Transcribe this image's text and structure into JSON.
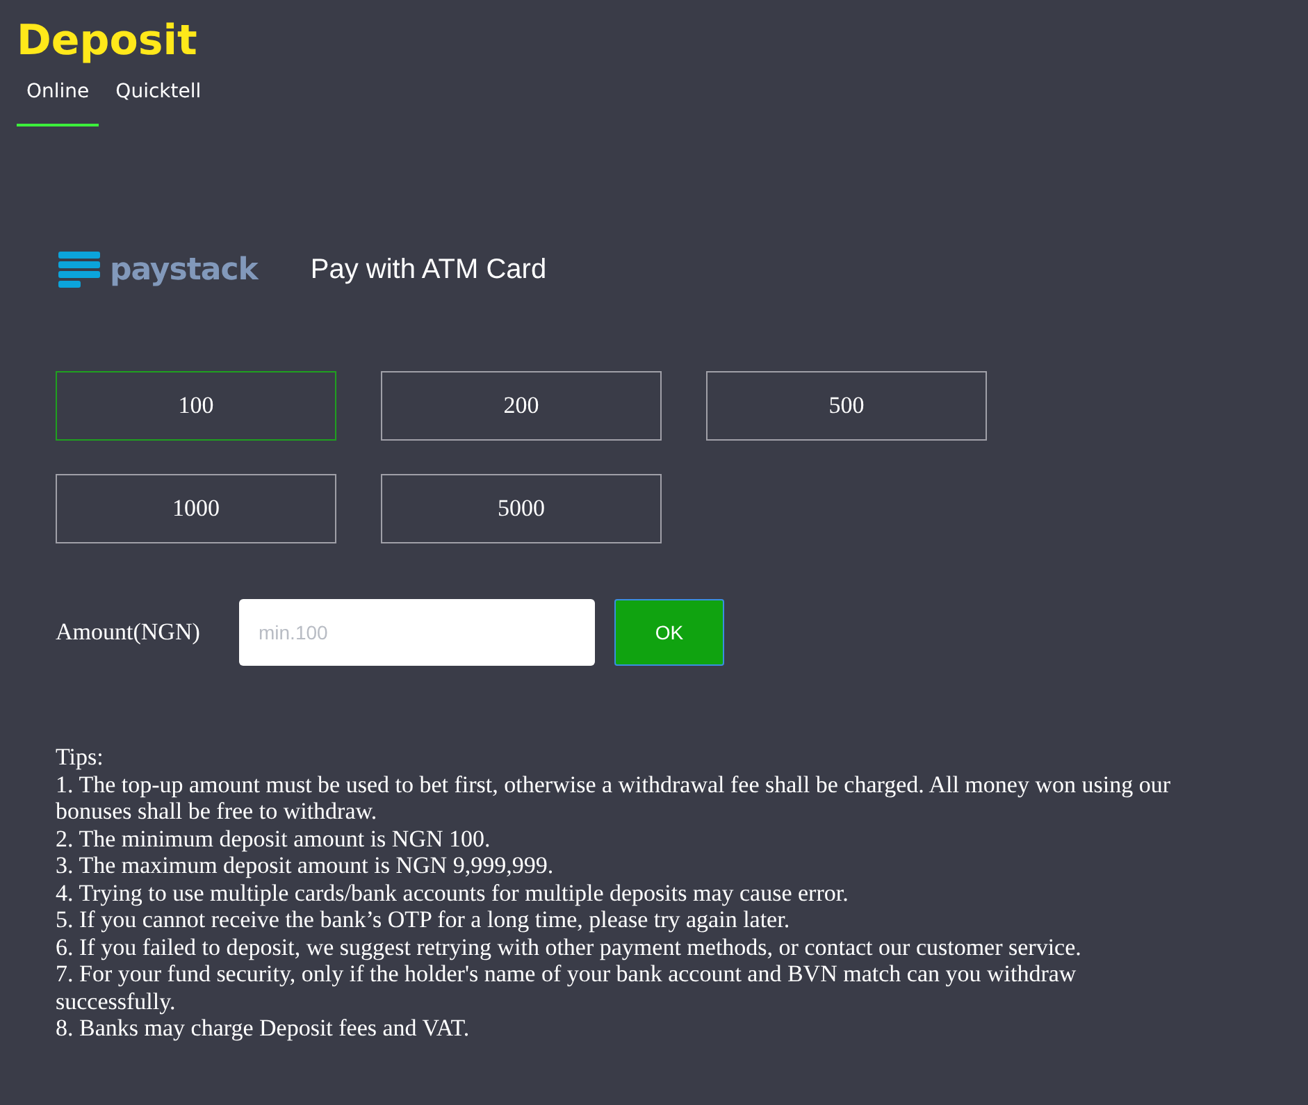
{
  "title": "Deposit",
  "tabs": [
    {
      "label": "Online",
      "selected": true
    },
    {
      "label": "Quicktell",
      "selected": false
    }
  ],
  "provider": {
    "logo_text": "paystack",
    "caption": "Pay with ATM Card"
  },
  "amounts": [
    {
      "label": "100",
      "selected": true
    },
    {
      "label": "200",
      "selected": false
    },
    {
      "label": "500",
      "selected": false
    },
    {
      "label": "1000",
      "selected": false
    },
    {
      "label": "5000",
      "selected": false
    }
  ],
  "amount_field": {
    "label": "Amount(NGN)",
    "placeholder": "min.100"
  },
  "ok_button": "OK",
  "tips": {
    "heading": "Tips:",
    "items": [
      "1. The top-up amount must be used to bet first, otherwise a withdrawal fee shall be charged. All money won using our bonuses shall be free to withdraw.",
      "2. The minimum deposit amount is NGN 100.",
      "3. The maximum deposit amount is NGN 9,999,999.",
      "4. Trying to use multiple cards/bank accounts for multiple deposits may cause error.",
      "5. If you cannot receive the bank’s OTP for a long time, please try again later.",
      "6. If you failed to deposit, we suggest retrying with other payment methods, or contact our customer service.",
      "7. For your fund security, only if the holder's name of your bank account and BVN match can you withdraw successfully.",
      "8. Banks may charge Deposit fees and VAT."
    ]
  }
}
